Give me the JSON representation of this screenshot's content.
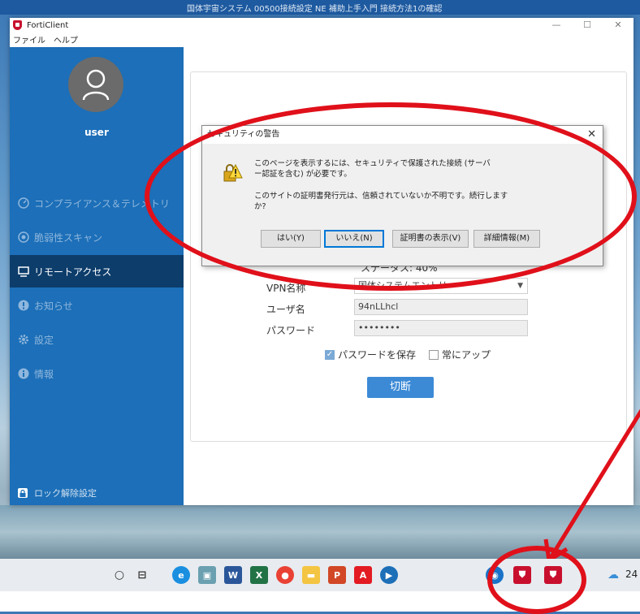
{
  "desktop": {
    "top_text": "国体宇宙システム  00500接続設定  NE 補助上手入門  接続方法1の確認"
  },
  "window": {
    "title": "FortiClient",
    "controls": {
      "minimize": "—",
      "maximize": "☐",
      "close": "✕"
    }
  },
  "menu": {
    "items": [
      "ファイル",
      "ヘルプ"
    ]
  },
  "sidebar": {
    "username": "user",
    "items": [
      {
        "label": "コンプライアンス＆テレメトリ",
        "icon": "gauge-icon"
      },
      {
        "label": "脆弱性スキャン",
        "icon": "scan-icon"
      },
      {
        "label": "リモートアクセス",
        "icon": "remote-access-icon"
      },
      {
        "label": "お知らせ",
        "icon": "notification-icon"
      },
      {
        "label": "設定",
        "icon": "gear-icon"
      },
      {
        "label": "情報",
        "icon": "info-icon"
      }
    ],
    "unlock_label": "ロック解除設定"
  },
  "vpn": {
    "status": "ステータス: 40%",
    "vpn_name_label": "VPN名称",
    "vpn_name_value": "国体システムエントリー",
    "username_label": "ユーザ名",
    "username_value": "94nLLhcl",
    "password_label": "パスワード",
    "password_value": "••••••••",
    "save_password_label": "パスワードを保存",
    "always_up_label": "常にアップ",
    "disconnect_label": "切断"
  },
  "dialog": {
    "title": "セキュリティの警告",
    "message1": "このページを表示するには、セキュリティで保護された接続 (サーバー認証を含む) が必要です。",
    "message2": "このサイトの証明書発行元は、信頼されていないか不明です。続行しますか?",
    "buttons": {
      "yes": "はい(Y)",
      "no": "いいえ(N)",
      "show_cert": "証明書の表示(V)",
      "details": "詳細情報(M)"
    }
  },
  "taskbar": {
    "time": "24"
  },
  "colors": {
    "sidebar": "#1c6fb8",
    "sidebar_active": "#0d3d6b",
    "accent_button": "#3c8ad6",
    "annotation_red": "#e0101a"
  }
}
